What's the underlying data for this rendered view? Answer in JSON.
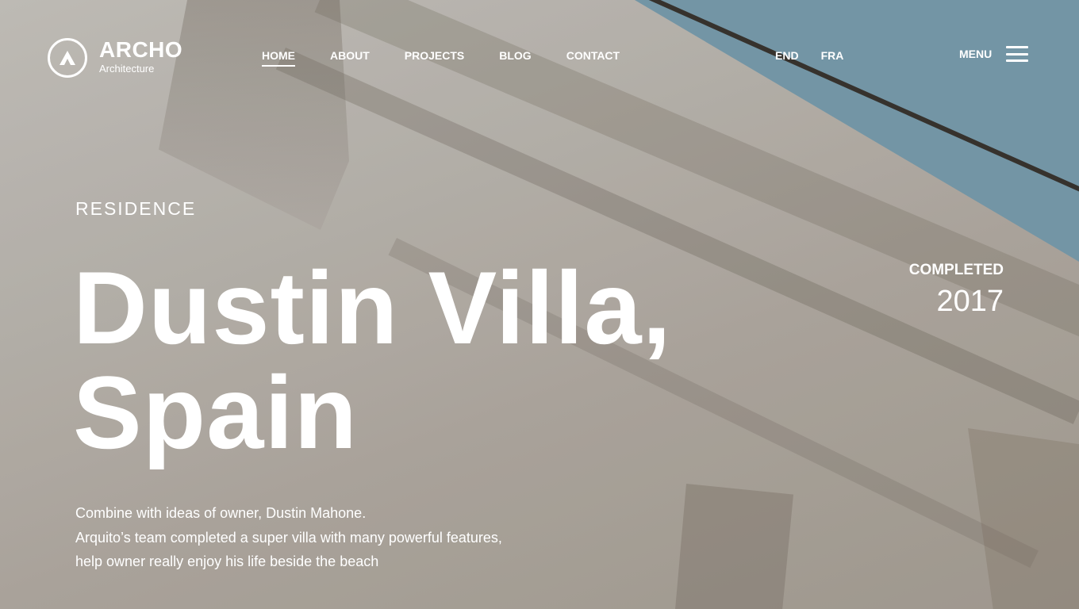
{
  "brand": {
    "name": "ARCHO",
    "tagline": "Architecture"
  },
  "nav": {
    "items": [
      {
        "label": "HOME"
      },
      {
        "label": "ABOUT"
      },
      {
        "label": "PROJECTS"
      },
      {
        "label": "BLOG"
      },
      {
        "label": "CONTACT"
      }
    ],
    "active": "HOME"
  },
  "languages": [
    "END",
    "FRA"
  ],
  "menu": {
    "label": "MENU"
  },
  "hero": {
    "category": "RESIDENCE",
    "title_line1": "Dustin Villa,",
    "title_line2": "Spain",
    "description": [
      "Combine with ideas of owner, Dustin Mahone.",
      "Arquito’s team completed a super villa with many powerful features,",
      "help owner really enjoy his life beside the beach"
    ],
    "status_label": "COMPLETED",
    "year": "2017"
  },
  "colors": {
    "sky": "#7b9fb0",
    "stone": "#c2bdb6",
    "text": "#ffffff"
  },
  "icons": {
    "logo": "archo-logo-icon",
    "menu": "hamburger-icon"
  }
}
